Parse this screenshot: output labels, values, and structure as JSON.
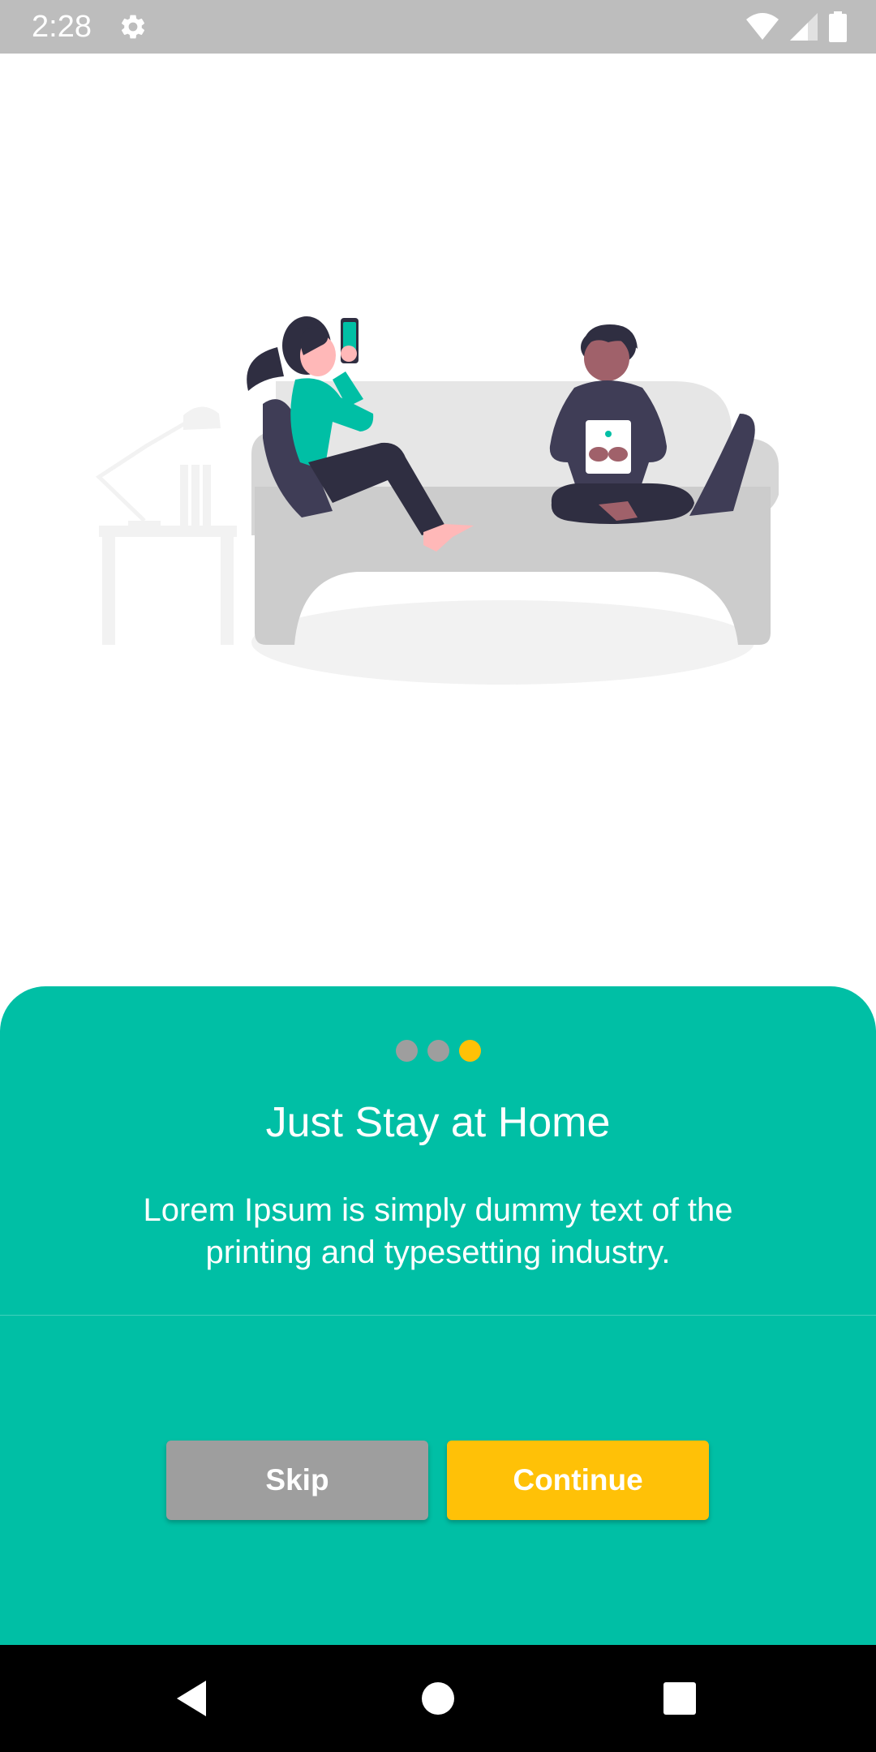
{
  "status_bar": {
    "time": "2:28",
    "icons": [
      "gear-icon",
      "wifi-icon",
      "signal-icon",
      "battery-icon"
    ],
    "background": "#bdbdbd"
  },
  "onboarding": {
    "page_indicator": {
      "count": 3,
      "active_index": 2
    },
    "title": "Just Stay at Home",
    "description": "Lorem Ipsum is simply dummy text of the printing and typesetting industry.",
    "skip_label": "Skip",
    "continue_label": "Continue"
  },
  "colors": {
    "sheet_background": "#00bfa5",
    "accent": "#ffc107",
    "skip_button": "#9e9e9e",
    "inactive_dot": "#9e9e9e"
  },
  "nav_bar": {
    "icons": [
      "back-icon",
      "home-icon",
      "recents-icon"
    ]
  }
}
